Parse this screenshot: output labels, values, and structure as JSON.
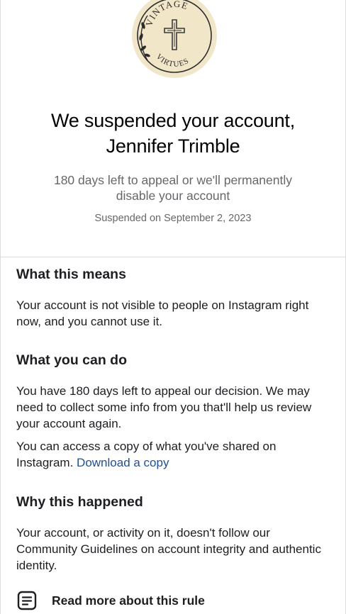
{
  "profile": {
    "logo_text_top": "VINTAGE",
    "logo_text_bottom": "VIRTUES",
    "logo_bg": "#f2e6c9"
  },
  "header": {
    "title_line1": "We suspended your account,",
    "title_line2": "Jennifer Trimble",
    "subtitle": "180 days left to appeal or we'll permanently disable your account",
    "suspended_date": "Suspended on September 2, 2023"
  },
  "sections": [
    {
      "heading": "What this means",
      "paragraphs": [
        "Your account is not visible to people on Instagram right now, and you cannot use it."
      ]
    },
    {
      "heading": "What you can do",
      "paragraphs": [
        "You have 180 days left to appeal our decision. We may need to collect some info from you that'll help us review your account again.",
        "You can access a copy of what you've shared on Instagram."
      ],
      "link_label": "Download a copy"
    },
    {
      "heading": "Why this happened",
      "paragraphs": [
        "Your account, or activity on it, doesn't follow our Community Guidelines on account integrity and authentic identity."
      ]
    }
  ],
  "rule_link": {
    "label": "Read more about this rule",
    "icon": "document-lines-icon"
  },
  "colors": {
    "link": "#1e4f9a",
    "muted": "#65676b",
    "divider": "#dbdbdb"
  }
}
